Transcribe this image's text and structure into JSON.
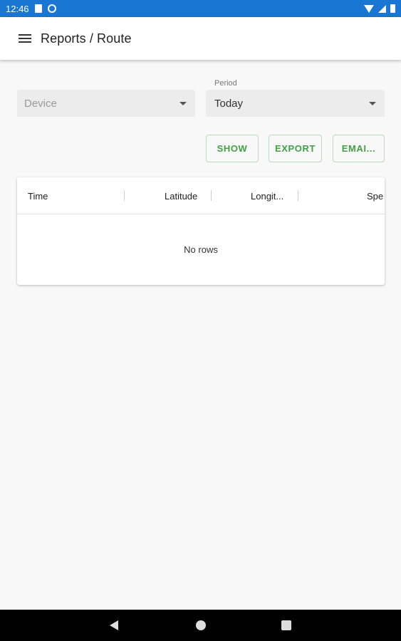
{
  "status_bar": {
    "time": "12:46",
    "bg_color": "#1976d2"
  },
  "app_bar": {
    "title": "Reports / Route"
  },
  "filters": {
    "device": {
      "value": "Device"
    },
    "period": {
      "label": "Period",
      "value": "Today"
    }
  },
  "actions": {
    "show_label": "SHOW",
    "export_label": "EXPORT",
    "email_label": "EMAI..."
  },
  "accent_color": "#43a047",
  "table": {
    "columns": [
      "Time",
      "Latitude",
      "Longit...",
      "Spe"
    ],
    "empty_text": "No rows"
  },
  "icons": {
    "status_bar": [
      "sd-card-icon",
      "sync-icon",
      "wifi-icon",
      "signal-icon",
      "battery-icon"
    ],
    "nav_bar": [
      "back-icon",
      "home-icon",
      "recent-apps-icon"
    ],
    "app_bar": [
      "menu-icon"
    ]
  }
}
